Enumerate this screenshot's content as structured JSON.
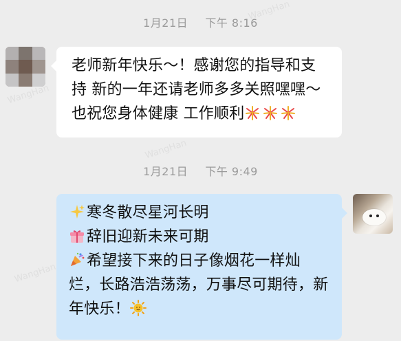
{
  "timestamps": [
    {
      "date": "1月21日",
      "time": "下午 8:16"
    },
    {
      "date": "1月21日",
      "time": "下午 9:49"
    }
  ],
  "messages": [
    {
      "sender": "teacher-side",
      "bubble_color": "#ffffff",
      "lines": [
        "老师新年快乐～！感谢您的指导和支",
        "持 新的一年还请老师多多关照嘿嘿～",
        "也祝您身体健康 工作顺利"
      ],
      "trailing_emojis": [
        "fireworks-icon",
        "fireworks-icon",
        "fireworks-icon"
      ]
    },
    {
      "sender": "self",
      "bubble_color": "#cfe7fb",
      "lines": [
        {
          "emoji": "sparkles-icon",
          "text": "寒冬散尽星河长明"
        },
        {
          "emoji": "gift-icon",
          "text": "辞旧迎新未来可期"
        },
        {
          "emoji": "party-popper-icon",
          "text": "希望接下来的日子像烟花一样灿"
        },
        {
          "emoji": "",
          "text": "烂，长路浩浩荡荡，万事尽可期待，新"
        },
        {
          "emoji": "",
          "text": "年快乐！",
          "trailing_emoji": "sun-icon"
        }
      ]
    }
  ],
  "colors": {
    "background": "#ededed",
    "timestamp": "#9a9a9a",
    "left_bubble": "#ffffff",
    "right_bubble": "#cfe7fb"
  }
}
